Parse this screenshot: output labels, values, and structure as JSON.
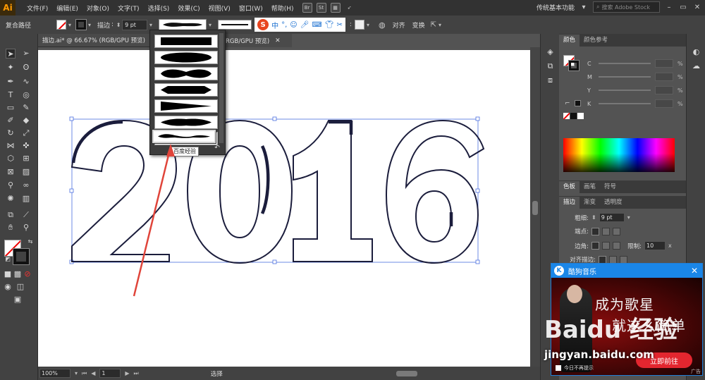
{
  "app": {
    "logo": "Ai"
  },
  "menu": {
    "items": [
      "文件(F)",
      "编辑(E)",
      "对象(O)",
      "文字(T)",
      "选择(S)",
      "效果(C)",
      "视图(V)",
      "窗口(W)",
      "帮助(H)"
    ]
  },
  "menu_right": {
    "bridge": "Br",
    "stock": "St",
    "workspace": "传统基本功能",
    "search_placeholder": "搜索 Adobe Stock"
  },
  "control": {
    "object_type": "复合路径",
    "stroke_label": "描边",
    "stroke_value": "9 pt",
    "align": "对齐",
    "transform": "变换"
  },
  "ime": {
    "logo": "S",
    "lang": "中"
  },
  "document": {
    "tab_title": "描边.ai* @ 66.67% (RGB/GPU 预览)",
    "tab_title_behind": "RGB/GPU 预览)"
  },
  "artwork": {
    "text": "2016"
  },
  "status": {
    "zoom": "100%",
    "page": "1",
    "tool": "选择"
  },
  "color_panel": {
    "tabs": [
      "颜色",
      "颜色参考"
    ],
    "channels": [
      "C",
      "M",
      "Y",
      "K"
    ],
    "unit": "%"
  },
  "swatch_tabs": [
    "色板",
    "画笔",
    "符号"
  ],
  "stroke_panel": {
    "tabs": [
      "描边",
      "渐变",
      "透明度"
    ],
    "weight_label": "粗细:",
    "weight_value": "9 pt",
    "cap_label": "端点:",
    "corner_label": "边角:",
    "limit_label": "限制:",
    "limit_value": "10",
    "limit_unit": "x",
    "align_label": "对齐描边:"
  },
  "profile_menu": {
    "tooltip": "百度经验",
    "selected_index": 6
  },
  "popup": {
    "title": "酷狗音乐",
    "logo": "K",
    "line1": "成为歌星",
    "line2": "就这么简单",
    "button": "立即前往",
    "note": "今日不再提示",
    "corner": "广告"
  },
  "watermark": {
    "brand": "Baidu 经验",
    "url": "jingyan.baidu.com"
  },
  "colors": {
    "menubar": "#323232",
    "panel": "#424242",
    "outline_stroke": "#1b1d3c",
    "annotation_arrow": "#e0443a",
    "ime_accent": "#1a6fd0",
    "popup_header": "#1a86e8"
  }
}
